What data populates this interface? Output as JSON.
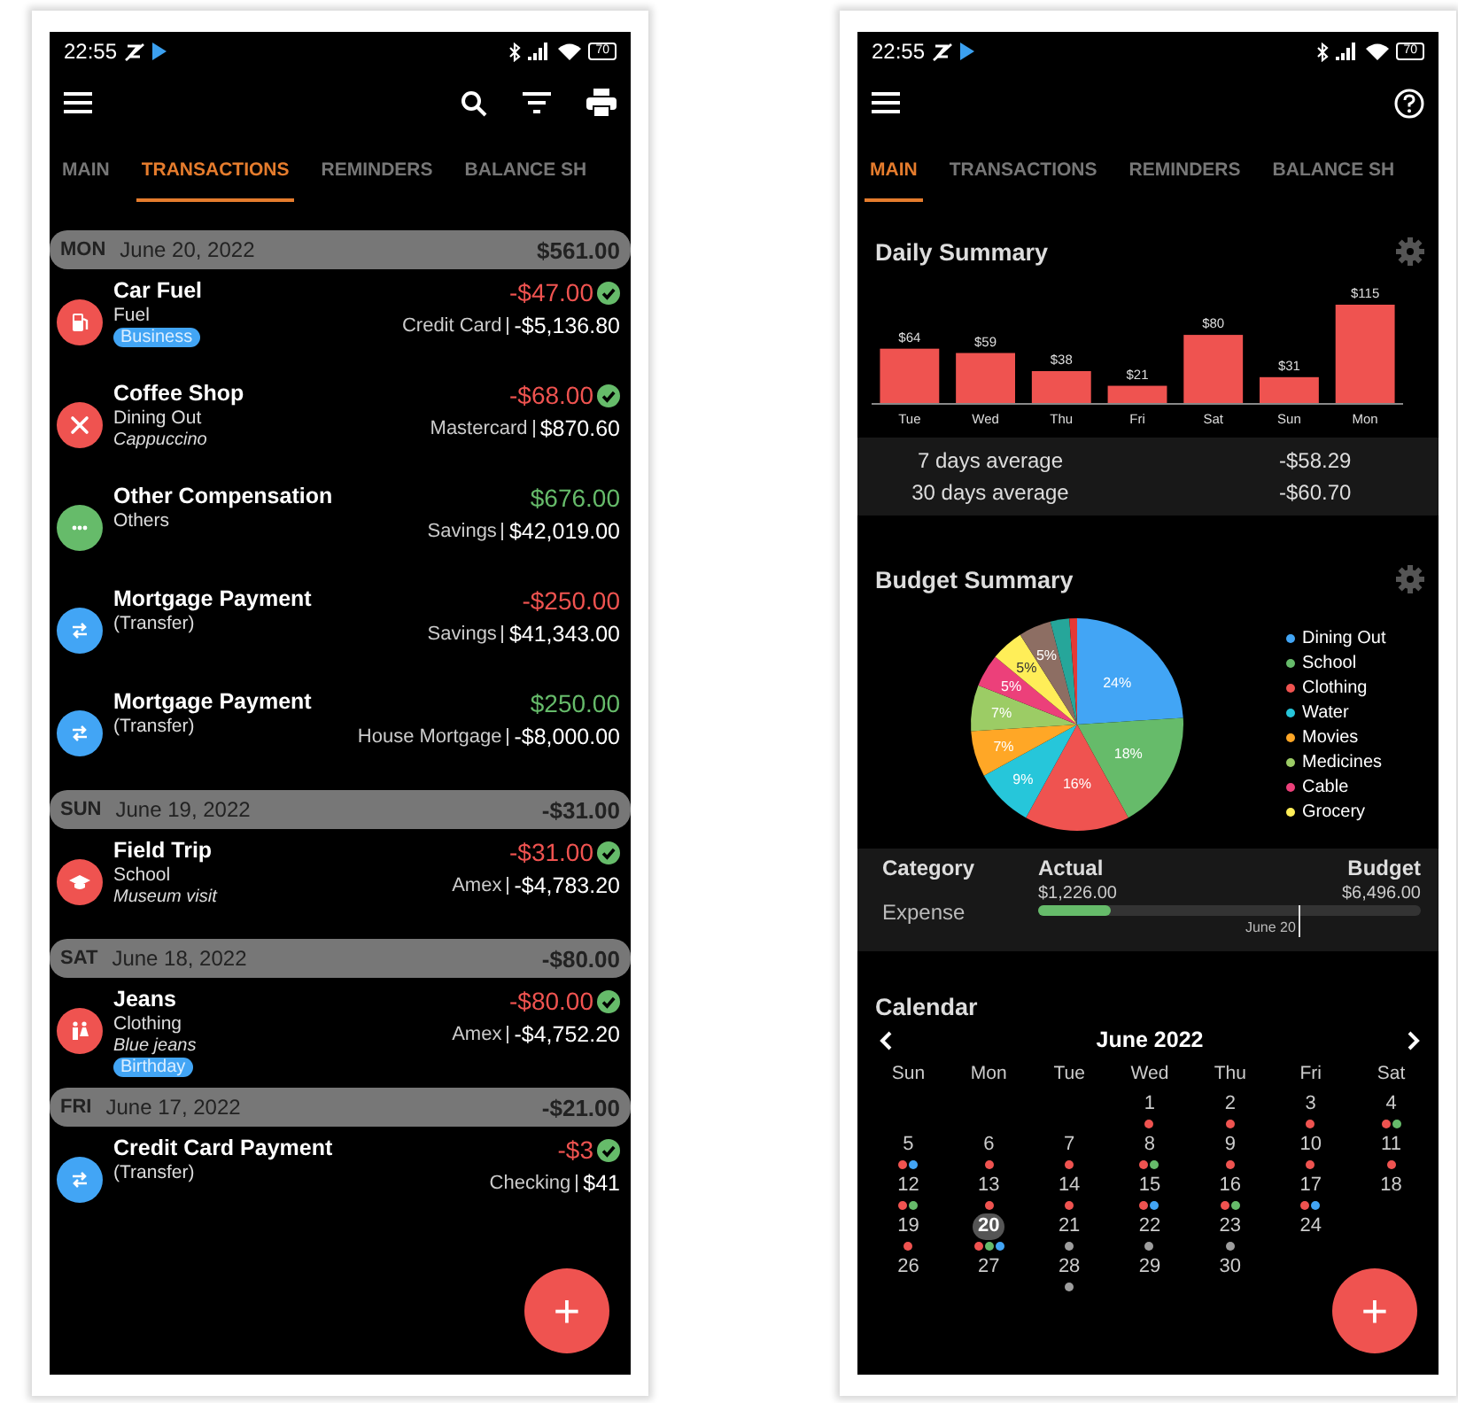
{
  "left_screen": {
    "status_bar": {
      "time": "22:55",
      "battery": "70"
    },
    "tabs": [
      {
        "label": "MAIN",
        "selected": false
      },
      {
        "label": "TRANSACTIONS",
        "selected": true
      },
      {
        "label": "REMINDERS",
        "selected": false
      },
      {
        "label": "BALANCE SH",
        "selected": false
      }
    ],
    "days": [
      {
        "weekday": "MON",
        "date": "June 20, 2022",
        "total": "$561.00",
        "transactions": [
          {
            "title": "Car Fuel",
            "kind": "fuel",
            "color": "#ef5350",
            "category": "Fuel",
            "tag": "Business",
            "amount": "-$47.00",
            "income": false,
            "cleared": true,
            "account": "Credit Card",
            "balance": "-$5,136.80"
          },
          {
            "title": "Coffee Shop",
            "kind": "dining",
            "color": "#ef5350",
            "category": "Dining Out",
            "note": "Cappuccino",
            "amount": "-$68.00",
            "income": false,
            "cleared": true,
            "account": "Mastercard",
            "balance": "$870.60"
          },
          {
            "title": "Other Compensation",
            "kind": "others",
            "color": "#66bb6a",
            "category": "Others",
            "amount": "$676.00",
            "income": true,
            "cleared": false,
            "account": "Savings",
            "balance": "$42,019.00"
          },
          {
            "title": "Mortgage Payment",
            "kind": "transfer",
            "color": "#42a5f5",
            "category": "(Transfer)",
            "amount": "-$250.00",
            "income": false,
            "cleared": false,
            "account": "Savings",
            "balance": "$41,343.00"
          },
          {
            "title": "Mortgage Payment",
            "kind": "transfer",
            "color": "#42a5f5",
            "category": "(Transfer)",
            "amount": "$250.00",
            "income": true,
            "cleared": false,
            "account": "House Mortgage",
            "balance": "-$8,000.00"
          }
        ]
      },
      {
        "weekday": "SUN",
        "date": "June 19, 2022",
        "total": "-$31.00",
        "transactions": [
          {
            "title": "Field Trip",
            "kind": "school",
            "color": "#ef5350",
            "category": "School",
            "note": "Museum visit",
            "amount": "-$31.00",
            "income": false,
            "cleared": true,
            "account": "Amex",
            "balance": "-$4,783.20"
          }
        ]
      },
      {
        "weekday": "SAT",
        "date": "June 18, 2022",
        "total": "-$80.00",
        "transactions": [
          {
            "title": "Jeans",
            "kind": "clothing",
            "color": "#ef5350",
            "category": "Clothing",
            "note": "Blue jeans",
            "tag": "Birthday",
            "amount": "-$80.00",
            "income": false,
            "cleared": true,
            "account": "Amex",
            "balance": "-$4,752.20"
          }
        ]
      },
      {
        "weekday": "FRI",
        "date": "June 17, 2022",
        "total": "-$21.00",
        "transactions": [
          {
            "title": "Credit Card Payment",
            "kind": "transfer",
            "color": "#42a5f5",
            "category": "(Transfer)",
            "amount": "-$3",
            "income": false,
            "cleared": true,
            "account": "Checking",
            "balance": "$41"
          }
        ]
      }
    ],
    "fab": "+"
  },
  "right_screen": {
    "status_bar": {
      "time": "22:55",
      "battery": "70"
    },
    "tabs": [
      {
        "label": "MAIN",
        "selected": true
      },
      {
        "label": "TRANSACTIONS",
        "selected": false
      },
      {
        "label": "REMINDERS",
        "selected": false
      },
      {
        "label": "BALANCE SH",
        "selected": false
      }
    ],
    "daily_summary": {
      "title": "Daily Summary",
      "chart_data": {
        "type": "bar",
        "categories": [
          "Tue",
          "Wed",
          "Thu",
          "Fri",
          "Sat",
          "Sun",
          "Mon"
        ],
        "values": [
          64,
          59,
          38,
          21,
          80,
          31,
          115
        ],
        "data_labels": true,
        "value_labels": [
          "$64",
          "$59",
          "$38",
          "$21",
          "$80",
          "$31",
          "$115"
        ]
      },
      "averages": [
        {
          "label": "7 days average",
          "value": "-$58.29"
        },
        {
          "label": "30 days average",
          "value": "-$60.70"
        }
      ]
    },
    "budget_summary": {
      "title": "Budget Summary",
      "chart_data": {
        "type": "pie",
        "categories": [
          "Dining Out",
          "School",
          "Clothing",
          "Water",
          "Movies",
          "Medicines",
          "Cable",
          "Grocery"
        ],
        "values": [
          24,
          18,
          16,
          9,
          7,
          7,
          5,
          5
        ],
        "colors": [
          "#42a5f5",
          "#66bb6a",
          "#ef5350",
          "#26c6da",
          "#ffa726",
          "#9ccc65",
          "#ec407a",
          "#ffee58"
        ],
        "data_labels": true,
        "value_labels": [
          "24%",
          "18%",
          "16%",
          "9%",
          "7%",
          "7%",
          "5%",
          "5%"
        ]
      },
      "unlabeled_slices": [
        {
          "color": "#8d6e63",
          "label": "5%"
        },
        {
          "color": "#26a69a"
        },
        {
          "color": "#e53935"
        }
      ],
      "table": {
        "columns": [
          "Category",
          "Actual",
          "Budget"
        ],
        "rows": [
          {
            "category": "Expense",
            "actual": "$1,226.00",
            "budget": "$6,496.00",
            "level": 0.19,
            "marker": {
              "label": "June 20",
              "level": 0.68
            }
          }
        ]
      }
    },
    "calendar": {
      "title": "Calendar",
      "month": "June 2022",
      "weekdays": [
        "Sun",
        "Mon",
        "Tue",
        "Wed",
        "Thu",
        "Fri",
        "Sat"
      ],
      "weeks": [
        [
          {
            "kind": "blank"
          },
          {
            "kind": "blank"
          },
          {
            "kind": "blank"
          },
          {
            "kind": "day",
            "day": "1",
            "selected": false,
            "dots": [
              {
                "color": "#ef5350"
              }
            ]
          },
          {
            "kind": "day",
            "day": "2",
            "selected": false,
            "dots": [
              {
                "color": "#ef5350"
              }
            ]
          },
          {
            "kind": "day",
            "day": "3",
            "selected": false,
            "dots": [
              {
                "color": "#ef5350"
              }
            ]
          },
          {
            "kind": "day",
            "day": "4",
            "selected": false,
            "dots": [
              {
                "color": "#ef5350"
              },
              {
                "color": "#66bb6a"
              }
            ]
          }
        ],
        [
          {
            "kind": "day",
            "day": "5",
            "selected": false,
            "dots": [
              {
                "color": "#ef5350"
              },
              {
                "color": "#42a5f5"
              }
            ]
          },
          {
            "kind": "day",
            "day": "6",
            "selected": false,
            "dots": [
              {
                "color": "#ef5350"
              }
            ]
          },
          {
            "kind": "day",
            "day": "7",
            "selected": false,
            "dots": [
              {
                "color": "#ef5350"
              }
            ]
          },
          {
            "kind": "day",
            "day": "8",
            "selected": false,
            "dots": [
              {
                "color": "#ef5350"
              },
              {
                "color": "#66bb6a"
              }
            ]
          },
          {
            "kind": "day",
            "day": "9",
            "selected": false,
            "dots": [
              {
                "color": "#ef5350"
              }
            ]
          },
          {
            "kind": "day",
            "day": "10",
            "selected": false,
            "dots": [
              {
                "color": "#ef5350"
              }
            ]
          },
          {
            "kind": "day",
            "day": "11",
            "selected": false,
            "dots": [
              {
                "color": "#ef5350"
              }
            ]
          }
        ],
        [
          {
            "kind": "day",
            "day": "12",
            "selected": false,
            "dots": [
              {
                "color": "#ef5350"
              },
              {
                "color": "#66bb6a"
              }
            ]
          },
          {
            "kind": "day",
            "day": "13",
            "selected": false,
            "dots": [
              {
                "color": "#ef5350"
              }
            ]
          },
          {
            "kind": "day",
            "day": "14",
            "selected": false,
            "dots": [
              {
                "color": "#ef5350"
              }
            ]
          },
          {
            "kind": "day",
            "day": "15",
            "selected": false,
            "dots": [
              {
                "color": "#ef5350"
              },
              {
                "color": "#42a5f5"
              }
            ]
          },
          {
            "kind": "day",
            "day": "16",
            "selected": false,
            "dots": [
              {
                "color": "#ef5350"
              },
              {
                "color": "#66bb6a"
              }
            ]
          },
          {
            "kind": "day",
            "day": "17",
            "selected": false,
            "dots": [
              {
                "color": "#ef5350"
              },
              {
                "color": "#42a5f5"
              }
            ]
          },
          {
            "kind": "day",
            "day": "18",
            "selected": false
          }
        ],
        [
          {
            "kind": "day",
            "day": "19",
            "selected": false,
            "dots": [
              {
                "color": "#ef5350"
              }
            ]
          },
          {
            "kind": "day",
            "day": "20",
            "selected": true,
            "dots": [
              {
                "color": "#ef5350"
              },
              {
                "color": "#66bb6a"
              },
              {
                "color": "#42a5f5"
              }
            ]
          },
          {
            "kind": "day",
            "day": "21",
            "selected": false,
            "dots": [
              {
                "color": "#9e9e9e"
              }
            ]
          },
          {
            "kind": "day",
            "day": "22",
            "selected": false,
            "dots": [
              {
                "color": "#9e9e9e"
              }
            ]
          },
          {
            "kind": "day",
            "day": "23",
            "selected": false,
            "dots": [
              {
                "color": "#9e9e9e"
              }
            ]
          },
          {
            "kind": "day",
            "day": "24",
            "selected": false
          },
          {
            "kind": "blank"
          }
        ],
        [
          {
            "kind": "day",
            "day": "26",
            "selected": false
          },
          {
            "kind": "day",
            "day": "27",
            "selected": false
          },
          {
            "kind": "day",
            "day": "28",
            "selected": false,
            "dots": [
              {
                "color": "#9e9e9e"
              }
            ]
          },
          {
            "kind": "day",
            "day": "29",
            "selected": false
          },
          {
            "kind": "day",
            "day": "30",
            "selected": false
          },
          {
            "kind": "blank"
          },
          {
            "kind": "blank"
          }
        ]
      ]
    },
    "fab": "+"
  }
}
